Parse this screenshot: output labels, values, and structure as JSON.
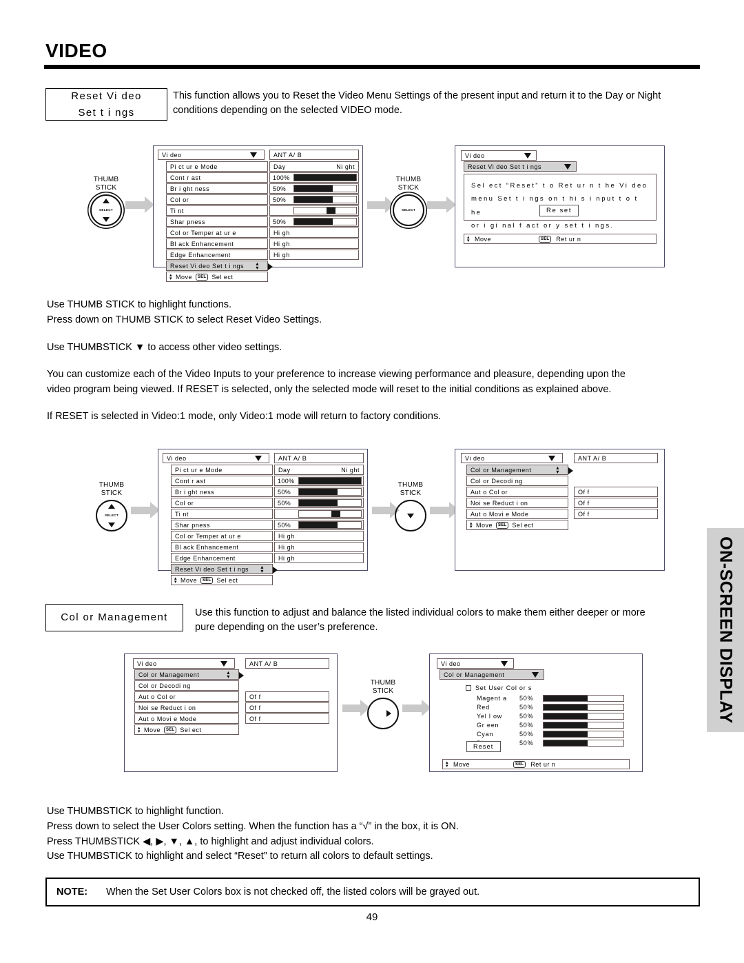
{
  "page": {
    "title": "VIDEO",
    "number": "49",
    "side_tab": "ON-SCREEN DISPLAY"
  },
  "sections": [
    {
      "label_line1": "Reset  Vi deo",
      "label_line2": "Set t i ngs",
      "desc_line1": "This function allows you to Reset the Video Menu Settings of the present input and return it to the Day or Night",
      "desc_line2": "conditions depending on the selected VIDEO mode."
    },
    {
      "label_line1": "Col or  Management",
      "label_line2": "",
      "desc_line1": "Use this function to adjust and balance the listed individual colors to make them either deeper or more",
      "desc_line2": "pure depending on the user’s preference."
    }
  ],
  "thumbstick": {
    "line1": "THUMB",
    "line2": "STICK",
    "select": "SELECT"
  },
  "video_menu": {
    "title": "Vi deo",
    "ant": "ANT  A/ B",
    "items": [
      "Pi ct ur e  Mode",
      "Cont r ast",
      "Br i ght ness",
      "Col or",
      "Ti nt",
      "Shar pness",
      "Col or   Temper at ur e",
      "Bl ack  Enhancement",
      "Edge  Enhancement"
    ],
    "highlighted_item": "Reset  Vi deo  Set t i ngs",
    "values": {
      "picture_mode_day": "Day",
      "picture_mode_night": "Ni ght",
      "contrast": "100%",
      "brightness": "50%",
      "color": "50%",
      "tint": "",
      "sharpness": "50%",
      "color_temperature": "Hi gh",
      "black_enhancement": "Hi gh",
      "edge_enhancement": "Hi gh"
    },
    "bars": {
      "contrast_pct": 100,
      "brightness_pct": 62,
      "color_pct": 62,
      "tint_knob_pct": 52,
      "sharpness_pct": 62
    },
    "footer_move": "Move",
    "footer_selkey": "SEL",
    "footer_action": "Sel ect"
  },
  "reset_screen": {
    "title": "Vi deo",
    "submenu": "Reset  Vi deo  Set t i ngs",
    "body_line1": "Sel ect  “Reset”  t o  Ret ur n  t he  Vi deo",
    "body_line2": "menu  Set t i ngs  on  t hi s  i nput  t o  t he",
    "body_line3": "or i gi nal  f act or y  set t i ngs.",
    "button": "Re set",
    "footer_move": "Move",
    "footer_selkey": "SEL",
    "footer_action": "Ret ur n"
  },
  "color_menu": {
    "title": "Vi deo",
    "ant": "ANT  A/ B",
    "highlighted_item": "Col or  Management",
    "items": [
      "Col or  Decodi ng",
      "Aut o  Col or",
      "Noi se  Reduct i on",
      "Aut o  Movi e  Mode"
    ],
    "values": [
      "Of f",
      "Of f",
      "Of f"
    ],
    "footer_move": "Move",
    "footer_selkey": "SEL",
    "footer_action": "Sel ect"
  },
  "color_detail": {
    "title": "Vi deo",
    "submenu": "Col or  Management",
    "checkbox_label": "Set  User  Col or s",
    "checkbox_checked": false,
    "colors": [
      {
        "name": "Magent a",
        "value": "50%",
        "pct": 55
      },
      {
        "name": "Red",
        "value": "50%",
        "pct": 55
      },
      {
        "name": "Yel l ow",
        "value": "50%",
        "pct": 55
      },
      {
        "name": "Gr een",
        "value": "50%",
        "pct": 55
      },
      {
        "name": "Cyan",
        "value": "50%",
        "pct": 55
      },
      {
        "name": "Bl ue",
        "value": "50%",
        "pct": 55
      }
    ],
    "reset_button": "Reset",
    "footer_move": "Move",
    "footer_selkey": "SEL",
    "footer_action": "Ret ur n"
  },
  "body_text": {
    "block1": [
      "Use THUMB STICK to highlight functions.",
      "Press down on THUMB STICK to select Reset Video Settings."
    ],
    "block2": [
      "Use THUMBSTICK ▼ to access other video settings."
    ],
    "block3": [
      "You can customize each of the Video Inputs to your preference to increase viewing performance and pleasure, depending upon the",
      "video program being viewed. If RESET is selected, only the selected mode will reset to the initial conditions as explained above."
    ],
    "block4": [
      "If RESET is selected in Video:1 mode, only Video:1 mode will return to factory conditions."
    ],
    "block5": [
      "Use THUMBSTICK to highlight function.",
      "Press down to select the User Colors setting.  When the function has a “√” in the box, it is ON.",
      "Press THUMBSTICK ◀, ▶, ▼, ▲, to highlight and adjust individual colors.",
      "Use THUMBSTICK to highlight and select “Reset” to return all colors to default settings."
    ]
  },
  "note": {
    "label": "NOTE:",
    "text": "When the Set User Colors box is not checked off, the listed colors will be grayed out."
  }
}
